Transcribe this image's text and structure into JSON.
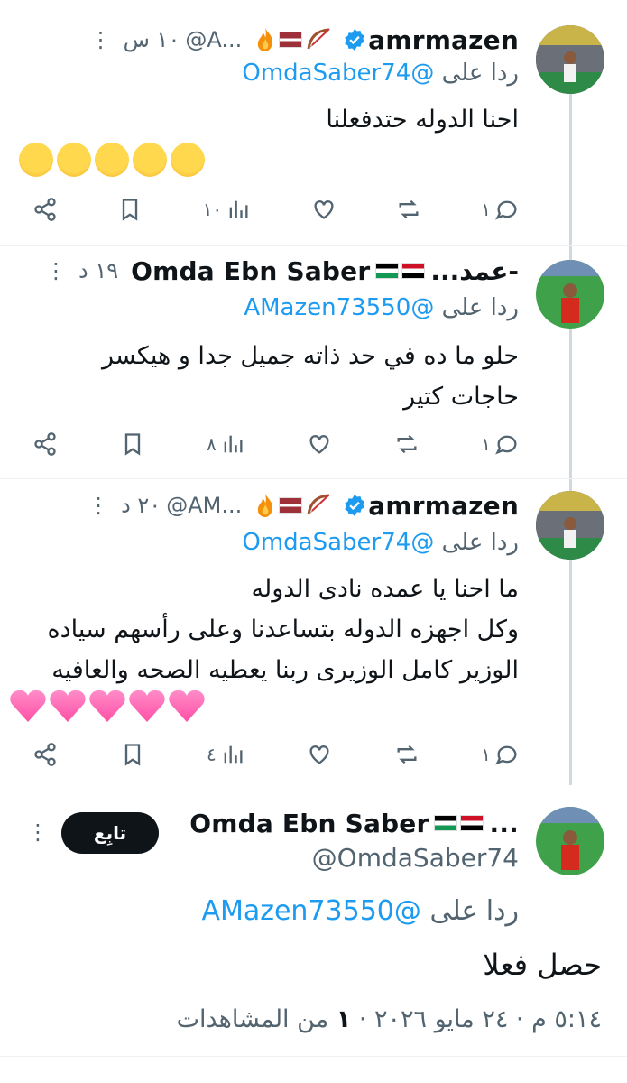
{
  "tweets": [
    {
      "name": "amrmazen",
      "handle": "@A...",
      "time": "١٠ س",
      "reply_prefix": "ردا على",
      "reply_mention": "@OmdaSaber74",
      "text_lines": [
        "احنا الدوله حتدفعلنا"
      ],
      "emoji_count": 5,
      "emoji_kind": "laugh",
      "replies": "١",
      "views": "١٠"
    },
    {
      "name": "Omda Ebn Saber",
      "name_prefix": "...عمد-",
      "time": "١٩ د",
      "reply_prefix": "ردا على",
      "reply_mention": "@AMazen73550",
      "text_lines": [
        "حلو ما ده في حد ذاته جميل جدا و هيكسر",
        "حاجات كتير"
      ],
      "replies": "١",
      "views": "٨"
    },
    {
      "name": "amrmazen",
      "handle": "@AM...",
      "time": "٢٠ د",
      "reply_prefix": "ردا على",
      "reply_mention": "@OmdaSaber74",
      "text_lines": [
        "ما احنا يا عمده نادى الدوله",
        "وكل اجهزه الدوله بتساعدنا وعلى رأسهم سياده",
        "الوزير كامل الوزيرى ربنا يعطيه الصحه والعافيه"
      ],
      "emoji_count": 5,
      "emoji_kind": "heart",
      "replies": "١",
      "views": "٤"
    }
  ],
  "main_tweet": {
    "name": "Omda Ebn Saber",
    "name_suffix": "...",
    "handle": "@OmdaSaber74",
    "follow_label": "تابِع",
    "reply_prefix": "ردا على",
    "reply_mention": "@AMazen73550",
    "text": "حصل فعلا",
    "timestamp": "٥:١٤ م · ٢٤ مايو ٢٠٢٦ · ",
    "views_count": "١",
    "views_label": " من المشاهدات"
  },
  "icons": [
    "reply-icon",
    "retweet-icon",
    "like-icon",
    "views-icon",
    "bookmark-icon",
    "share-icon",
    "verified-icon",
    "more-icon"
  ],
  "colors": {
    "accent": "#1d9bf0",
    "muted": "#536471",
    "thread_line": "#cfd9de"
  }
}
